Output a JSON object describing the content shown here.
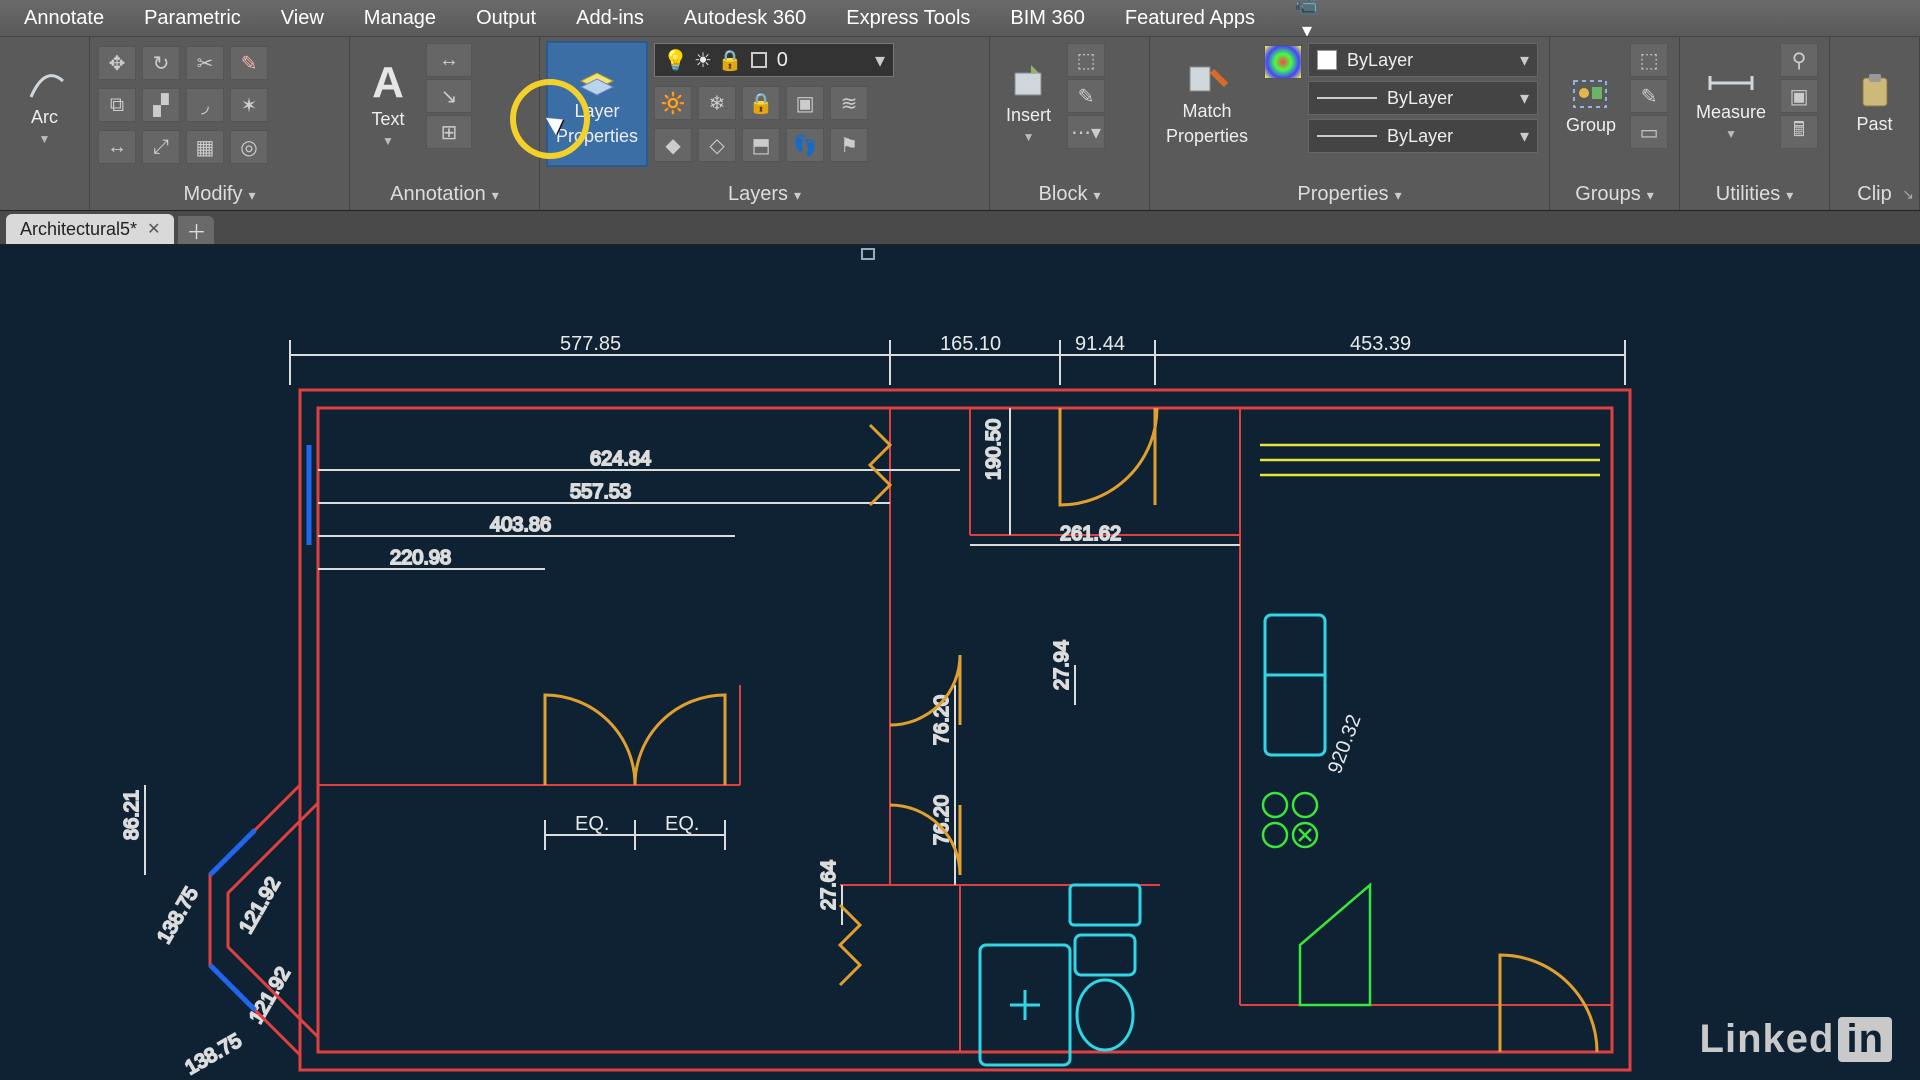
{
  "menu": {
    "items": [
      "Annotate",
      "Parametric",
      "View",
      "Manage",
      "Output",
      "Add-ins",
      "Autodesk 360",
      "Express Tools",
      "BIM 360",
      "Featured Apps"
    ]
  },
  "ribbon": {
    "draw": {
      "big_label": "Arc"
    },
    "modify": {
      "title": "Modify"
    },
    "annotation": {
      "big_label": "Text",
      "title": "Annotation"
    },
    "layers": {
      "big_label_line1": "Layer",
      "big_label_line2": "Properties",
      "current_layer": "0",
      "title": "Layers"
    },
    "block": {
      "big_label": "Insert",
      "title": "Block"
    },
    "properties": {
      "big_label_line1": "Match",
      "big_label_line2": "Properties",
      "color": "ByLayer",
      "lineweight": "ByLayer",
      "linetype": "ByLayer",
      "title": "Properties"
    },
    "groups": {
      "big_label": "Group",
      "title": "Groups"
    },
    "utilities": {
      "big_label": "Measure",
      "title": "Utilities"
    },
    "clipboard": {
      "big_label": "Past",
      "title": "Clip"
    }
  },
  "tabs": {
    "active": "Architectural5*"
  },
  "dimensions": {
    "top": [
      "577.85",
      "165.10",
      "91.44",
      "453.39"
    ],
    "h_interior": [
      "624.84",
      "557.53",
      "403.86",
      "220.98",
      "261.62"
    ],
    "v_interior": [
      "190.50",
      "76.20",
      "27.94",
      "76.20",
      "27.64"
    ],
    "left_side": [
      "86.21",
      "138.75",
      "121.92",
      "121.92",
      "138.75"
    ],
    "diag": "920.32",
    "eq": "EQ."
  },
  "watermark": {
    "brand": "Linked",
    "suffix": "in"
  }
}
